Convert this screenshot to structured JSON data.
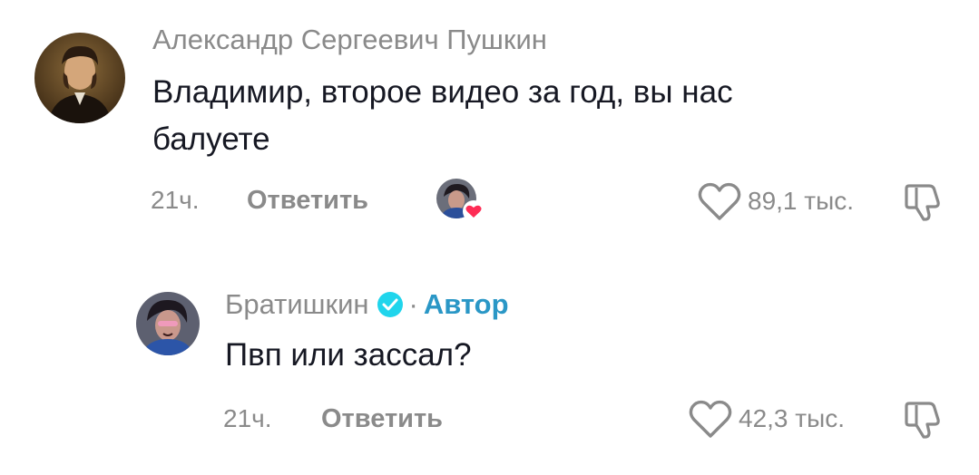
{
  "comments": [
    {
      "author": "Александр Сергеевич Пушкин",
      "text_line1": "Владимир, второе видео за год, вы нас",
      "text_line2": "балуете",
      "time": "21ч.",
      "reply_label": "Ответить",
      "likes": "89,1 тыс.",
      "liked_by_creator": true
    },
    {
      "author": "Братишкин",
      "verified": true,
      "badge_separator": "·",
      "badge": "Автор",
      "text": "Пвп или зассал?",
      "time": "21ч.",
      "reply_label": "Ответить",
      "likes": "42,3 тыс."
    }
  ],
  "colors": {
    "meta_gray": "#8a8a8a",
    "text_dark": "#161823",
    "author_badge": "#2a97c6",
    "verified_badge": "#20d5ec",
    "heart_red": "#fe2c55"
  }
}
